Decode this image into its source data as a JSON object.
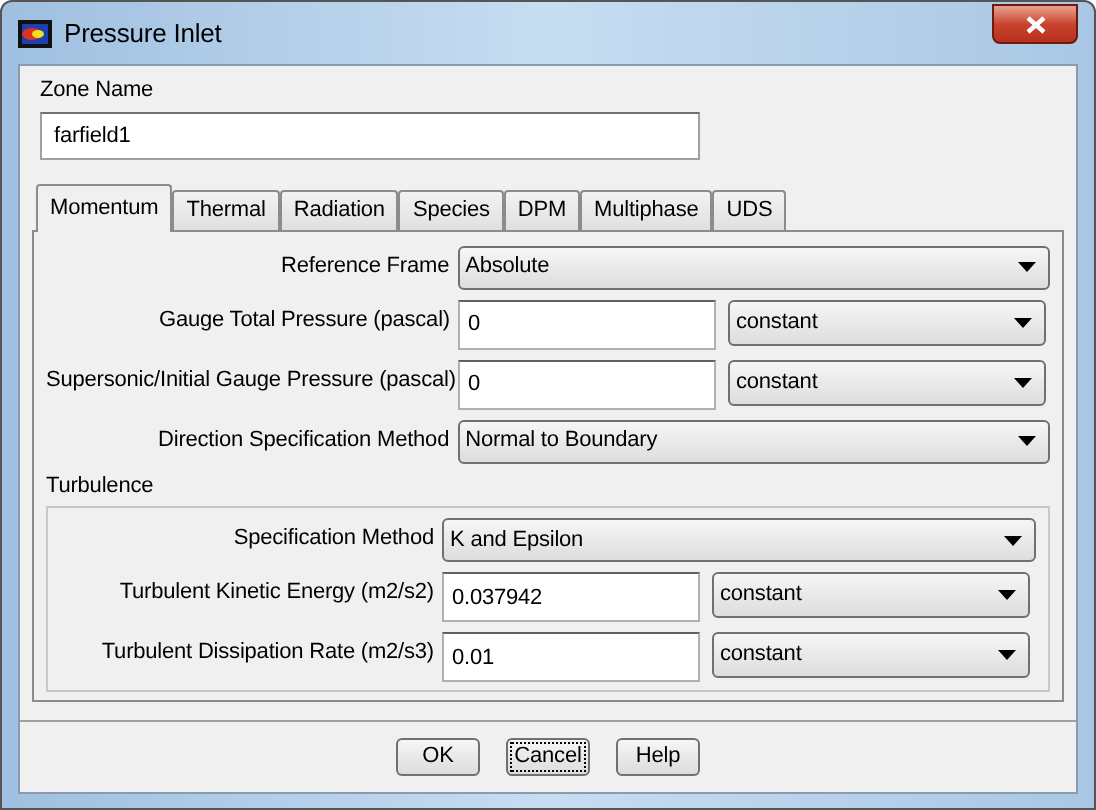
{
  "window": {
    "title": "Pressure Inlet"
  },
  "zone_name": {
    "label": "Zone Name",
    "value": "farfield1"
  },
  "tabs": [
    {
      "label": "Momentum",
      "selected": true
    },
    {
      "label": "Thermal",
      "selected": false
    },
    {
      "label": "Radiation",
      "selected": false
    },
    {
      "label": "Species",
      "selected": false
    },
    {
      "label": "DPM",
      "selected": false
    },
    {
      "label": "Multiphase",
      "selected": false
    },
    {
      "label": "UDS",
      "selected": false
    }
  ],
  "fields": [
    {
      "kind": "dropdown",
      "label": "Reference Frame",
      "value": "Absolute"
    },
    {
      "kind": "input_dropdown",
      "label": "Gauge Total Pressure (pascal)",
      "value": "0",
      "option": "constant"
    },
    {
      "kind": "input_dropdown",
      "label": "Supersonic/Initial Gauge Pressure (pascal)",
      "value": "0",
      "option": "constant"
    },
    {
      "kind": "dropdown",
      "label": "Direction Specification Method",
      "value": "Normal to Boundary"
    }
  ],
  "turbulence": {
    "title": "Turbulence",
    "fields": [
      {
        "kind": "dropdown",
        "label": "Specification Method",
        "value": "K and Epsilon"
      },
      {
        "kind": "input_dropdown",
        "label": "Turbulent Kinetic Energy (m2/s2)",
        "value": "0.037942",
        "option": "constant"
      },
      {
        "kind": "input_dropdown",
        "label": "Turbulent Dissipation Rate (m2/s3)",
        "value": "0.01",
        "option": "constant"
      }
    ]
  },
  "buttons": [
    {
      "label": "OK",
      "focused": false
    },
    {
      "label": "Cancel",
      "focused": true
    },
    {
      "label": "Help",
      "focused": false
    }
  ]
}
